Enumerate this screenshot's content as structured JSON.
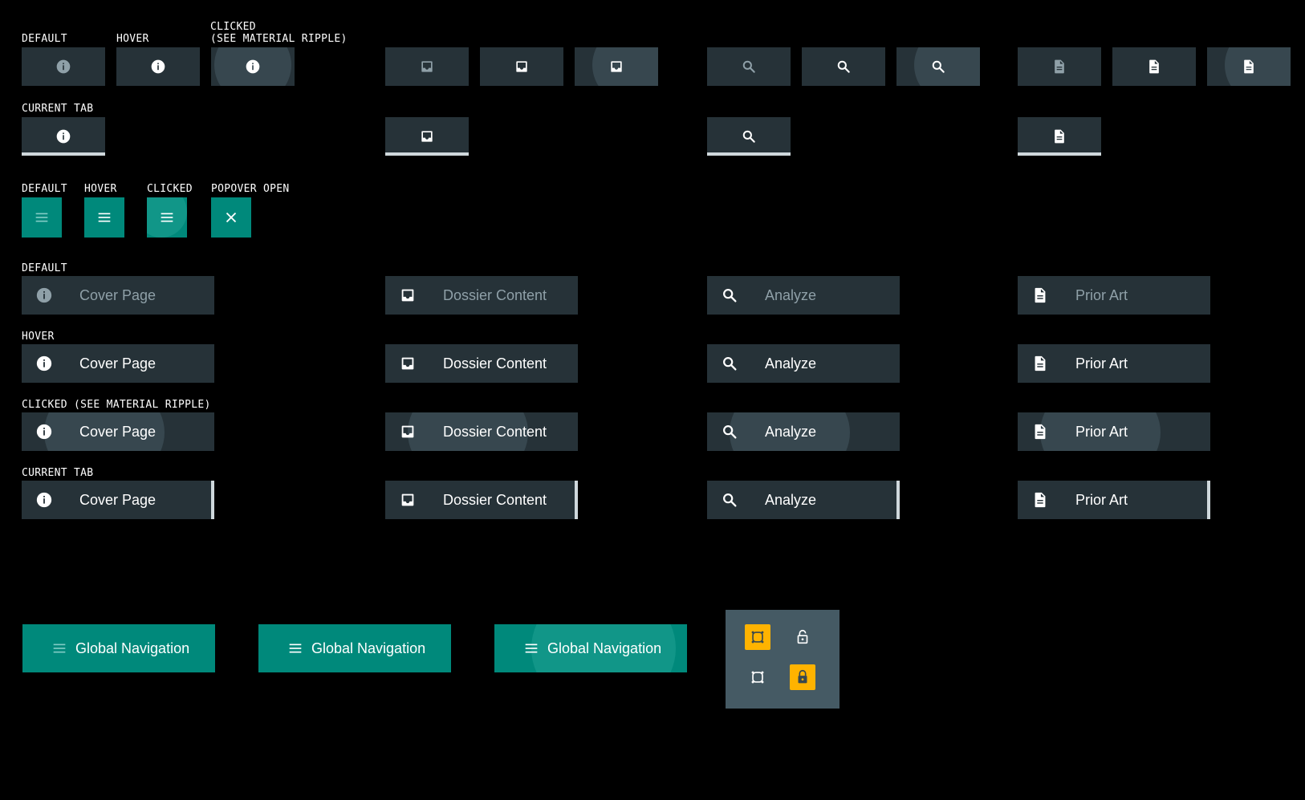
{
  "labels": {
    "default": "DEFAULT",
    "hover": "HOVER",
    "clicked_ripple": "CLICKED\n(SEE MATERIAL RIPPLE)",
    "current_tab": "CURRENT TAB",
    "clicked": "CLICKED",
    "popover_open": "POPOVER OPEN",
    "clicked_ripple_inline": "CLICKED (SEE MATERIAL RIPPLE)"
  },
  "tabs": [
    {
      "name": "Cover Page",
      "icon": "info-icon"
    },
    {
      "name": "Dossier Content",
      "icon": "inbox-icon"
    },
    {
      "name": "Analyze",
      "icon": "search-icon"
    },
    {
      "name": "Prior Art",
      "icon": "document-icon"
    }
  ],
  "hamburger_states": [
    "DEFAULT",
    "HOVER",
    "CLICKED",
    "POPOVER OPEN"
  ],
  "hamburger_icons": [
    "menu-icon",
    "menu-icon",
    "menu-icon",
    "close-icon"
  ],
  "global_navigation": {
    "label": "Global Navigation",
    "icon": "menu-icon"
  },
  "lock_panel": {
    "icons": [
      "focus-frame-icon",
      "lock-open-icon",
      "focus-frame-icon",
      "lock-closed-icon"
    ],
    "active": [
      true,
      false,
      false,
      true
    ]
  },
  "colors": {
    "background": "#000000",
    "tab_bg": "#263238",
    "ripple": "#37474f",
    "teal": "#00897b",
    "current_indicator": "#cfd8dc",
    "lock_panel_bg": "#455a64",
    "lock_active": "#ffb300"
  }
}
